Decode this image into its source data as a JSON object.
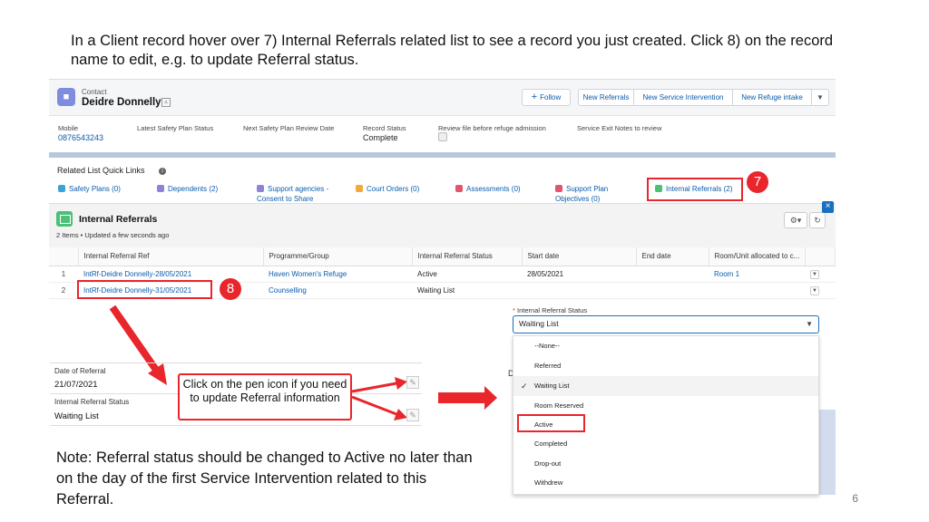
{
  "slide": {
    "intro": "In a Client record hover over 7) Internal Referrals related list to see a record you just created. Click 8) on the record name to edit, e.g. to update Referral status.",
    "note": "Note: Referral status should be changed to Active no later than on the day of the first Service Intervention related to this Referral.",
    "page_number": "6",
    "callout": "Click on the pen icon if you need to update Referral information",
    "badge_7": "7",
    "badge_8": "8"
  },
  "header": {
    "object_type": "Contact",
    "name": "Deidre Donnelly",
    "buttons": {
      "follow": "Follow",
      "new_referrals": "New Referrals",
      "new_service_intervention": "New Service Intervention",
      "new_refuge_intake": "New Refuge intake"
    },
    "fields": [
      {
        "label": "Mobile",
        "value": "0876543243"
      },
      {
        "label": "Latest Safety Plan Status",
        "value": ""
      },
      {
        "label": "Next Safety Plan Review Date",
        "value": ""
      },
      {
        "label": "Record Status",
        "value": "Complete"
      },
      {
        "label": "Review file before refuge admission",
        "value": ""
      },
      {
        "label": "Service Exit Notes to review",
        "value": ""
      }
    ]
  },
  "quick_links": {
    "title": "Related List Quick Links",
    "items": [
      {
        "label": "Safety Plans (0)",
        "color": "#3ea4d8"
      },
      {
        "label": "Dependents (2)",
        "color": "#8c84d8"
      },
      {
        "label": "Support agencies - Consent to Share",
        "color": "#8c84d8"
      },
      {
        "label": "Court Orders (0)",
        "color": "#f0a93b"
      },
      {
        "label": "Assessments (0)",
        "color": "#e2556a"
      },
      {
        "label": "Support Plan Objectives (0)",
        "color": "#e2556a"
      },
      {
        "label": "Internal Referrals (2)",
        "color": "#4bc076"
      }
    ]
  },
  "related_list": {
    "title": "Internal Referrals",
    "subtitle": "2 Items • Updated a few seconds ago",
    "columns": [
      "",
      "Internal Referral Ref",
      "Programme/Group",
      "Internal Referral Status",
      "Start date",
      "End date",
      "Room/Unit allocated to c...",
      ""
    ],
    "rows": [
      {
        "num": "1",
        "ref": "IntRf-Deidre Donnelly-28/05/2021",
        "programme": "Haven Women's Refuge",
        "status": "Active",
        "start": "28/05/2021",
        "end": "",
        "room": "Room 1"
      },
      {
        "num": "2",
        "ref": "IntRf-Deidre Donnelly-31/05/2021",
        "programme": "Counselling",
        "status": "Waiting List",
        "start": "",
        "end": "",
        "room": ""
      }
    ]
  },
  "detail_panel": {
    "date_label": "Date of Referral",
    "date_value": "21/07/2021",
    "status_label": "Internal Referral Status",
    "status_value": "Waiting List"
  },
  "status_dropdown": {
    "label": "Internal Referral Status",
    "required_mark": "*",
    "selected": "Waiting List",
    "options": [
      "--None--",
      "Referred",
      "Waiting List",
      "Room Reserved",
      "Active",
      "Completed",
      "Drop-out",
      "Withdrew"
    ],
    "stub": "D"
  },
  "colors": {
    "accent_red": "#e8262b",
    "link_blue": "#0b5cab",
    "focus_blue": "#1b6fc0"
  }
}
